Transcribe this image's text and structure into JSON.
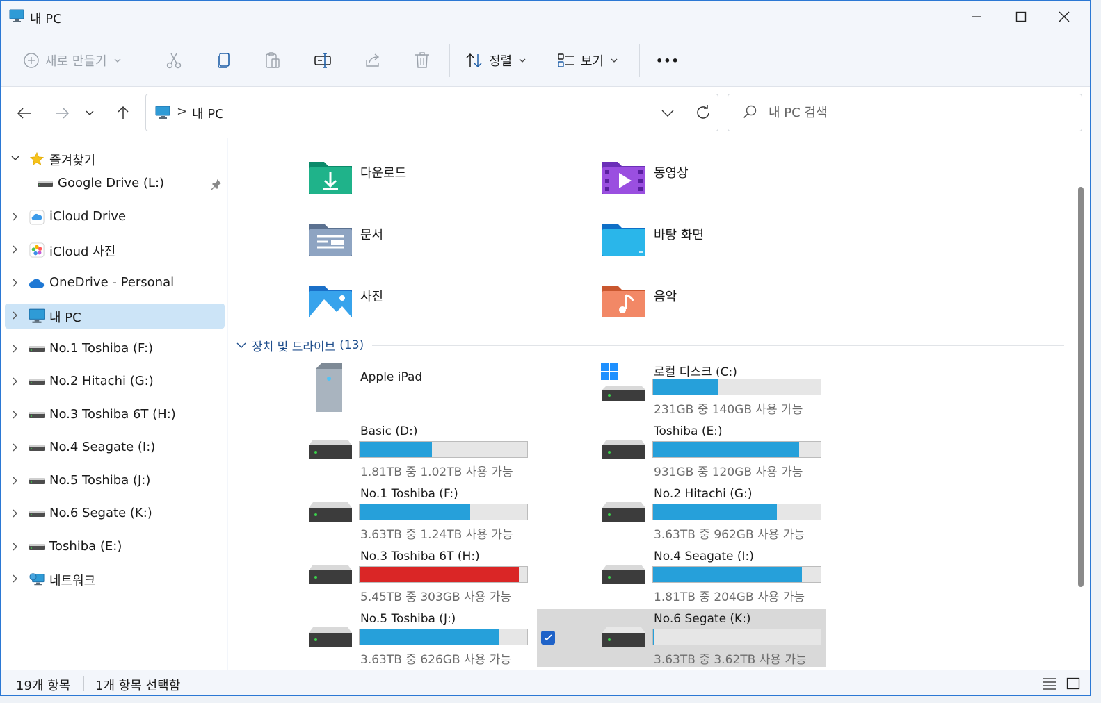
{
  "window": {
    "title": "내 PC"
  },
  "toolbar": {
    "new_label": "새로 만들기",
    "sort_label": "정렬",
    "view_label": "보기",
    "more_label": "•••"
  },
  "address": {
    "path": "내 PC",
    "separator": ">",
    "search_placeholder": "내 PC 검색"
  },
  "sidebar": {
    "favorites": "즐겨찾기",
    "google_drive": "Google Drive (L:)",
    "items": [
      "iCloud Drive",
      "iCloud 사진",
      "OneDrive - Personal",
      "내 PC",
      "No.1 Toshiba (F:)",
      "No.2 Hitachi (G:)",
      "No.3 Toshiba 6T (H:)",
      "No.4 Seagate (I:)",
      "No.5 Toshiba (J:)",
      "No.6 Segate (K:)",
      "Toshiba (E:)",
      "네트워크"
    ]
  },
  "folders": [
    {
      "name": "다운로드",
      "icon": "downloads-folder-icon"
    },
    {
      "name": "동영상",
      "icon": "videos-folder-icon"
    },
    {
      "name": "문서",
      "icon": "documents-folder-icon"
    },
    {
      "name": "바탕 화면",
      "icon": "desktop-folder-icon"
    },
    {
      "name": "사진",
      "icon": "pictures-folder-icon"
    },
    {
      "name": "음악",
      "icon": "music-folder-icon"
    }
  ],
  "devices_group": {
    "title": "장치 및 드라이브",
    "count": "(13)"
  },
  "drives": [
    {
      "name": "Apple iPad",
      "free": "",
      "used_fraction": null
    },
    {
      "name": "로컬 디스크 (C:)",
      "free": "231GB 중 140GB 사용 가능",
      "used_fraction": 0.39
    },
    {
      "name": "Basic (D:)",
      "free": "1.81TB 중 1.02TB 사용 가능",
      "used_fraction": 0.43
    },
    {
      "name": "Toshiba (E:)",
      "free": "931GB 중 120GB 사용 가능",
      "used_fraction": 0.87
    },
    {
      "name": "No.1 Toshiba (F:)",
      "free": "3.63TB 중 1.24TB 사용 가능",
      "used_fraction": 0.66
    },
    {
      "name": "No.2 Hitachi (G:)",
      "free": "3.63TB 중 962GB 사용 가능",
      "used_fraction": 0.74
    },
    {
      "name": "No.3 Toshiba 6T (H:)",
      "free": "5.45TB 중 303GB 사용 가능",
      "used_fraction": 0.95
    },
    {
      "name": "No.4 Seagate (I:)",
      "free": "1.81TB 중 204GB 사용 가능",
      "used_fraction": 0.89
    },
    {
      "name": "No.5 Toshiba (J:)",
      "free": "3.63TB 중 626GB 사용 가능",
      "used_fraction": 0.83
    },
    {
      "name": "No.6 Segate (K:)",
      "free": "3.63TB 중 3.62TB 사용 가능",
      "used_fraction": 0.003
    }
  ],
  "status": {
    "item_count": "19개 항목",
    "selected": "1개 항목 선택함"
  },
  "colors": {
    "accent": "#26a0da",
    "warning": "#da2626",
    "selection": "#cce4f7"
  }
}
